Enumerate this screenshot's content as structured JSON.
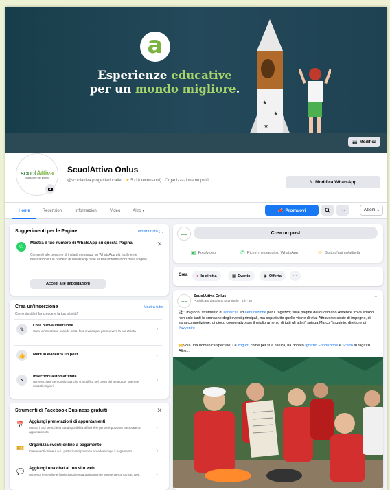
{
  "cover": {
    "logo_letter": "a",
    "headline_line1_prefix": "Esperienze ",
    "headline_line1_green": "educative",
    "headline_line2_prefix": "per un ",
    "headline_line2_green": "mondo migliore",
    "headline_line2_suffix": ".",
    "edit_label": "Modifica"
  },
  "profile": {
    "avatar_brand_prefix": "scuol",
    "avatar_brand_accent": "Attiva",
    "avatar_sub": "educazione per il futuro",
    "name": "ScuolAttiva Onlus",
    "handle": "@scuolattiva.progettieducativi",
    "rating": "5",
    "reviews": "18 recensioni",
    "category": "Organizzazione no profit",
    "whatsapp_button": "Modifica WhatsApp"
  },
  "tabs": [
    {
      "label": "Home",
      "active": true
    },
    {
      "label": "Recensioni",
      "active": false
    },
    {
      "label": "Informazioni",
      "active": false
    },
    {
      "label": "Video",
      "active": false
    },
    {
      "label": "Altro ▾",
      "active": false
    }
  ],
  "actions": {
    "promote_label": "Promuovi",
    "search_icon": "search-icon",
    "more_label": "···",
    "dropdown_label": "Azioni"
  },
  "suggestions": {
    "title": "Suggerimenti per le Pagine",
    "link": "Mostra tutto (1)",
    "item_title": "Mostra il tuo numero di WhatsApp su questa Pagina",
    "item_desc": "Consenti alle persone di inviarti messaggi su WhatsApp più facilmente mostrando il tuo numero di WhatsApp nelle sezioni informazioni della Pagina.",
    "button": "Accedi alle impostazioni"
  },
  "ads": {
    "title": "Crea un'inserzione",
    "link": "Mostra tutto",
    "subtitle": "Come desideri far crescere la tua attività?",
    "items": [
      {
        "title": "Crea nuova inserzione",
        "desc": "Crea un'inserzione usando testo, foto o video per promuovere la tua attività"
      },
      {
        "title": "Metti in evidenza un post",
        "desc": ""
      },
      {
        "title": "Inserzioni automatizzate",
        "desc": "Un'inserzione personalizzata che si modifica nel corso del tempo per ottenere risultati migliori"
      }
    ]
  },
  "tools": {
    "title": "Strumenti di Facebook Business gratuiti",
    "items": [
      {
        "title": "Aggiungi prenotazioni di appuntamenti",
        "desc": "Mostra i tuoi servizi e la tua disponibilità affinché le persone possano prenotare un appuntamento."
      },
      {
        "title": "Organizza eventi online a pagamento",
        "desc": "Crea eventi online a cui i partecipanti possono accedere dopo il pagamento."
      },
      {
        "title": "Aggiungi una chat al tuo sito web",
        "desc": "Aumenta le vendite e fornisci assistenza aggiungendo Messenger al tuo sito web."
      }
    ]
  },
  "composer": {
    "avatar": "scuol",
    "placeholder": "Crea un post",
    "actions": [
      {
        "icon": "photo-icon",
        "label": "Foto/video"
      },
      {
        "icon": "whatsapp-icon",
        "label": "Ricevi messaggi su WhatsApp"
      },
      {
        "icon": "smile-icon",
        "label": "Stato d'animo/attività"
      }
    ]
  },
  "create": {
    "label": "Crea",
    "pills": [
      "In diretta",
      "Evento",
      "Offerta"
    ],
    "more": "···"
  },
  "post": {
    "author": "ScuolAttiva Onlus",
    "meta": "Pubblicato da Laura Scarabelo",
    "date": "4 h",
    "text1_prefix": "\"Un gioco, strumento di ",
    "text1_tag1": "#crescita",
    "text1_mid": " ed ",
    "text1_tag2": "#educazione",
    "text1_rest": " per il ragazzo; sulle pagine del quotidiano Avvenire trova spazio non solo tanti le cronache degli eventi principali, ma soprattutto quelle vicine di vita. Attraverso storie di impegno, di sana competizione, di gioco cooperativo per il miglioramento di tutti gli atleti\" spiega Marco Tarquinio, direttore di ",
    "text1_tag3": "#avvenire",
    "text2_prefix": "Vola una domenica speciale! Le ",
    "text2_tag1": "Yogurt",
    "text2_mid": ", come per sua natura, ha donato ",
    "text2_tag2": "Ignazio",
    "text2_mid2": " ",
    "text2_tag3": "Fondazione",
    "text2_mid3": " e ",
    "text2_tag4": "Scatto",
    "text2_suffix": " ai ragazzi... Altro...",
    "more": "···"
  }
}
